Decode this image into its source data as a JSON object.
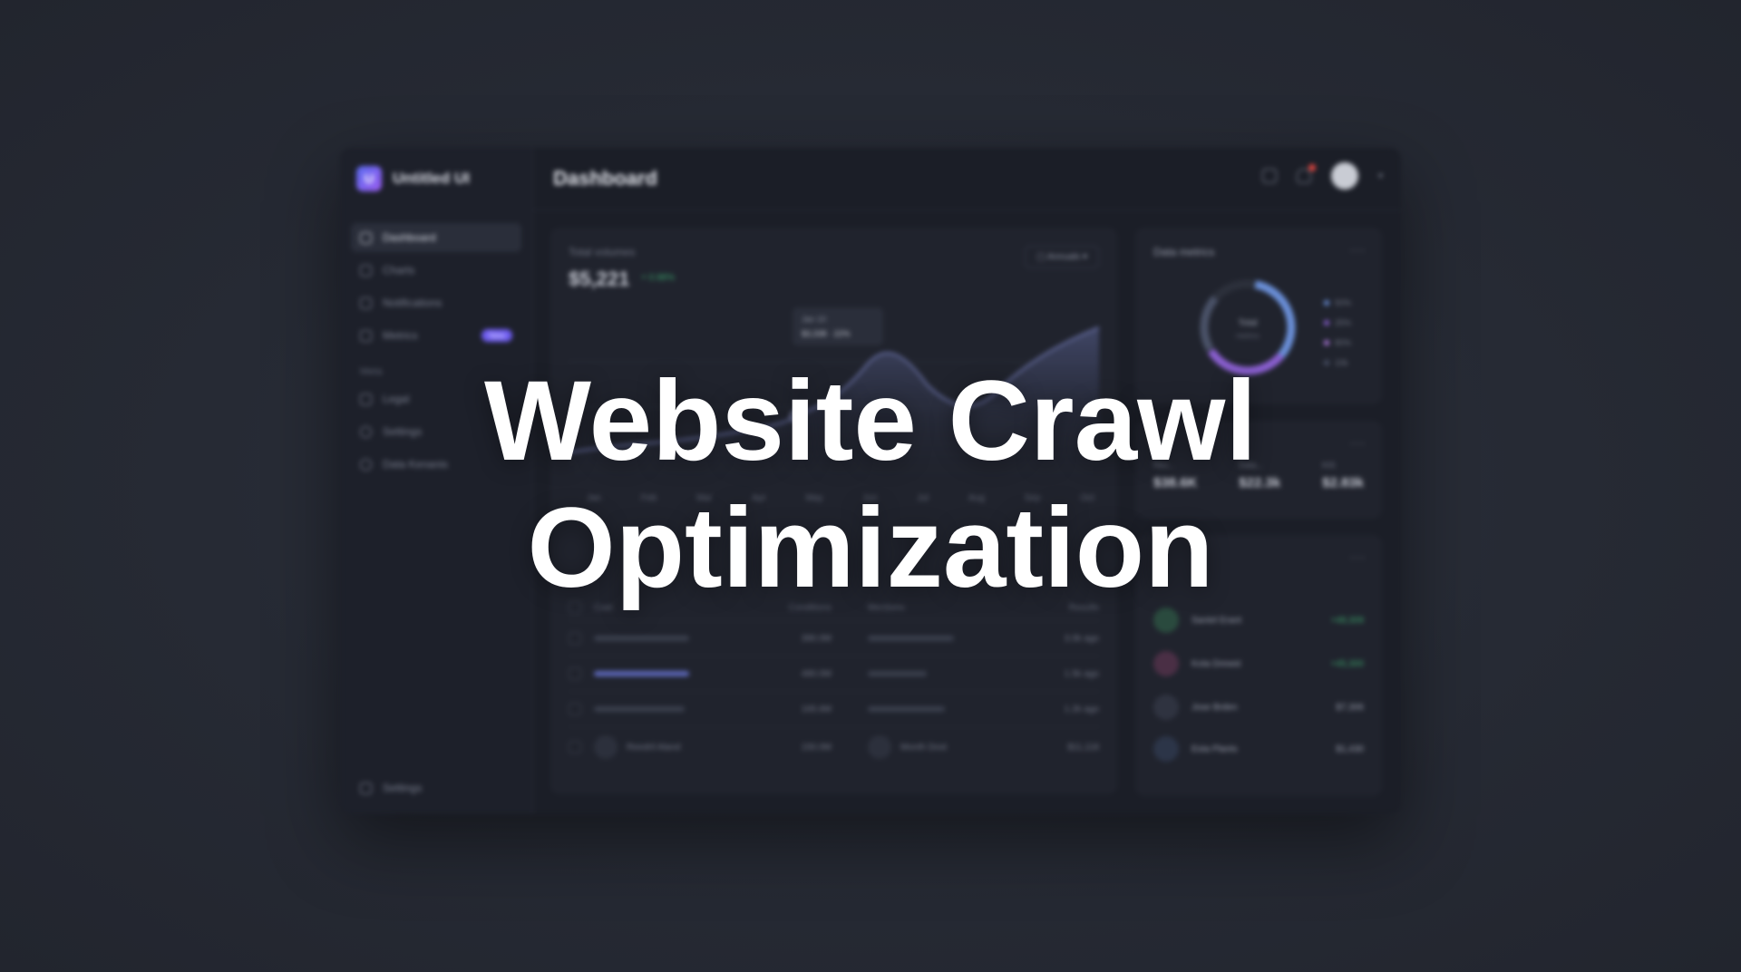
{
  "headline": {
    "line1": "Website Crawl",
    "line2": "Optimization"
  },
  "app": {
    "brand_name": "Untitled UI",
    "page_title": "Dashboard",
    "sidebar": {
      "items": [
        {
          "label": "Dashboard",
          "icon": "grid-icon",
          "active": true
        },
        {
          "label": "Charts",
          "icon": "bar-chart-icon"
        },
        {
          "label": "Notifications",
          "icon": "trend-icon"
        },
        {
          "label": "Metrics",
          "icon": "table-icon",
          "badge": "New"
        }
      ],
      "section_label": "Meta",
      "section_items": [
        {
          "label": "Legal",
          "icon": "lock-icon"
        },
        {
          "label": "Settings",
          "icon": "gear-icon"
        },
        {
          "label": "Data Kenanis",
          "icon": "circle-icon"
        }
      ],
      "footer_label": "Settings"
    },
    "main_card": {
      "label": "Total volumes",
      "value": "$5,221",
      "delta": "+ 0.98%",
      "period": "Annuals",
      "tooltip_title": "Jan 10",
      "tooltip_value": "$3,338 · 22%",
      "months": [
        "Jan",
        "Feb",
        "Mar",
        "Apr",
        "May",
        "Jun",
        "Jul",
        "Aug",
        "Sep",
        "Oct"
      ]
    },
    "metrics_card": {
      "title": "Data metrics",
      "center_label": "Total",
      "center_sub": "metrics",
      "legend": [
        "50%",
        "25%",
        "80%",
        "10k"
      ]
    },
    "stats_card": {
      "stats": [
        {
          "label": "Rev...",
          "value": "$38.6K"
        },
        {
          "label": "Data...",
          "value": "$22.3k"
        },
        {
          "label": "KIS",
          "value": "$2.83k"
        }
      ]
    },
    "list_card": {
      "people": [
        {
          "name": "Santel Erant",
          "amount": "+48,309"
        },
        {
          "name": "Kota Drewst",
          "amount": "+45,300"
        },
        {
          "name": "Jose Brden",
          "amount": "$7,306"
        },
        {
          "name": "Esta Plants",
          "amount": "$1,430"
        }
      ]
    },
    "table": {
      "headers": [
        "Cost",
        "Conditions",
        "Mentions",
        "Results"
      ],
      "rows": [
        {
          "c2": "390.0M",
          "c4": "3.0k ago"
        },
        {
          "c2": "480.0M",
          "c4": "1.5k ago"
        },
        {
          "c2": "165.6M",
          "c4": "1.2k ago"
        },
        {
          "name": "Reedril Aland",
          "c2": "150.0M",
          "name2": "Month Dost",
          "c4": "$11,118"
        }
      ]
    },
    "colors": {
      "accent": "#6e5cf0",
      "positive": "#3ca56c",
      "alert": "#e0453f"
    }
  }
}
